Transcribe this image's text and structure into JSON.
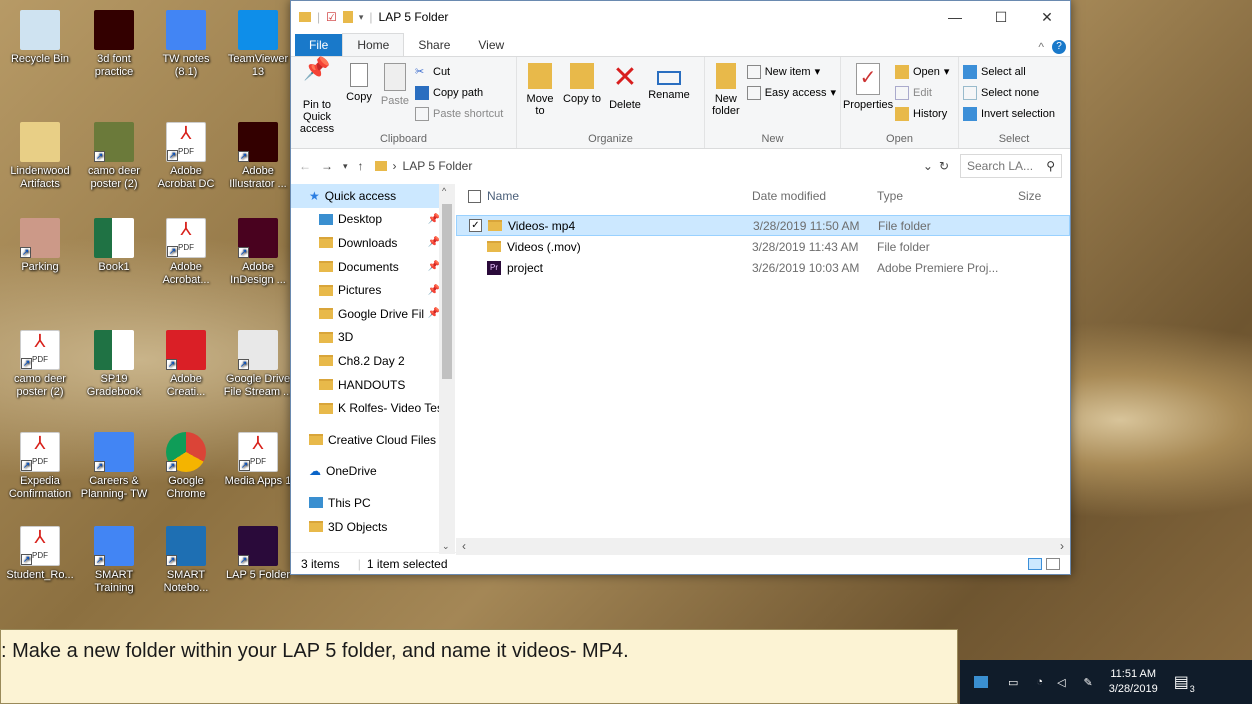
{
  "desktop_icons": [
    {
      "label": "Recycle Bin",
      "icon": "recycle-bin-icon"
    },
    {
      "label": "3d font practice",
      "icon": "illustrator-file-icon"
    },
    {
      "label": "TW notes (8.1)",
      "icon": "google-doc-icon"
    },
    {
      "label": "TeamViewer 13",
      "icon": "teamviewer-icon"
    },
    {
      "label": "Lindenwood Artifacts",
      "icon": "folder-icon"
    },
    {
      "label": "camo deer poster (2)",
      "icon": "image-icon"
    },
    {
      "label": "Adobe Acrobat DC",
      "icon": "acrobat-icon"
    },
    {
      "label": "Adobe Illustrator ...",
      "icon": "illustrator-icon"
    },
    {
      "label": "Parking",
      "icon": "parking-file-icon"
    },
    {
      "label": "Book1",
      "icon": "excel-icon"
    },
    {
      "label": "Adobe Acrobat...",
      "icon": "acrobat-icon"
    },
    {
      "label": "Adobe InDesign ...",
      "icon": "indesign-icon"
    },
    {
      "label": "camo deer poster (2)",
      "icon": "pdf-icon"
    },
    {
      "label": "SP19 Gradebook",
      "icon": "excel-icon"
    },
    {
      "label": "Adobe Creati...",
      "icon": "creative-cloud-icon"
    },
    {
      "label": "Google Drive File Stream ...",
      "icon": "drive-icon"
    },
    {
      "label": "Expedia Confirmation",
      "icon": "pdf-icon"
    },
    {
      "label": "Careers & Planning- TW",
      "icon": "google-doc-icon"
    },
    {
      "label": "Google Chrome",
      "icon": "chrome-icon"
    },
    {
      "label": "Media Apps 1",
      "icon": "pdf-icon"
    },
    {
      "label": "Student_Ro...",
      "icon": "pdf-icon"
    },
    {
      "label": "SMART Training",
      "icon": "google-doc-icon"
    },
    {
      "label": "SMART Notebo...",
      "icon": "smart-notebook-icon"
    },
    {
      "label": "LAP 5 Folder",
      "icon": "premiere-icon"
    }
  ],
  "window": {
    "title": "LAP 5 Folder",
    "tabs": [
      "File",
      "Home",
      "Share",
      "View"
    ],
    "ribbon": {
      "clipboard": {
        "pin": "Pin to Quick access",
        "copy": "Copy",
        "paste": "Paste",
        "cut": "Cut",
        "copy_path": "Copy path",
        "paste_shortcut": "Paste shortcut",
        "label": "Clipboard"
      },
      "organize": {
        "move": "Move to",
        "copy": "Copy to",
        "delete": "Delete",
        "rename": "Rename",
        "label": "Organize"
      },
      "new": {
        "new_folder": "New folder",
        "new_item": "New item",
        "easy_access": "Easy access",
        "label": "New"
      },
      "open": {
        "properties": "Properties",
        "open": "Open",
        "edit": "Edit",
        "history": "History",
        "label": "Open"
      },
      "select": {
        "all": "Select all",
        "none": "Select none",
        "invert": "Invert selection",
        "label": "Select"
      }
    },
    "address": {
      "path": "LAP 5 Folder",
      "search_placeholder": "Search LA..."
    },
    "nav": [
      {
        "label": "Quick access",
        "pin": false
      },
      {
        "label": "Desktop",
        "pin": true
      },
      {
        "label": "Downloads",
        "pin": true
      },
      {
        "label": "Documents",
        "pin": true
      },
      {
        "label": "Pictures",
        "pin": true
      },
      {
        "label": "Google Drive Fil",
        "pin": true
      },
      {
        "label": "3D",
        "pin": false
      },
      {
        "label": "Ch8.2 Day 2",
        "pin": false
      },
      {
        "label": "HANDOUTS",
        "pin": false
      },
      {
        "label": "K Rolfes- Video Tes",
        "pin": false
      },
      {
        "label": "Creative Cloud Files",
        "pin": false
      },
      {
        "label": "OneDrive",
        "pin": false
      },
      {
        "label": "This PC",
        "pin": false
      },
      {
        "label": "3D Objects",
        "pin": false
      }
    ],
    "columns": {
      "name": "Name",
      "date": "Date modified",
      "type": "Type",
      "size": "Size"
    },
    "files": [
      {
        "name": "Videos- mp4",
        "date": "3/28/2019 11:50 AM",
        "type": "File folder",
        "selected": true
      },
      {
        "name": "Videos (.mov)",
        "date": "3/28/2019 11:43 AM",
        "type": "File folder",
        "selected": false
      },
      {
        "name": "project",
        "date": "3/26/2019 10:03 AM",
        "type": "Adobe Premiere Proj...",
        "selected": false
      }
    ],
    "status": {
      "count": "3 items",
      "selected": "1 item selected"
    }
  },
  "taskbar": {
    "time": "11:51 AM",
    "date": "3/28/2019",
    "notifications": "3"
  },
  "caption": ": Make a new folder within your LAP 5 folder, and name it videos- MP4."
}
